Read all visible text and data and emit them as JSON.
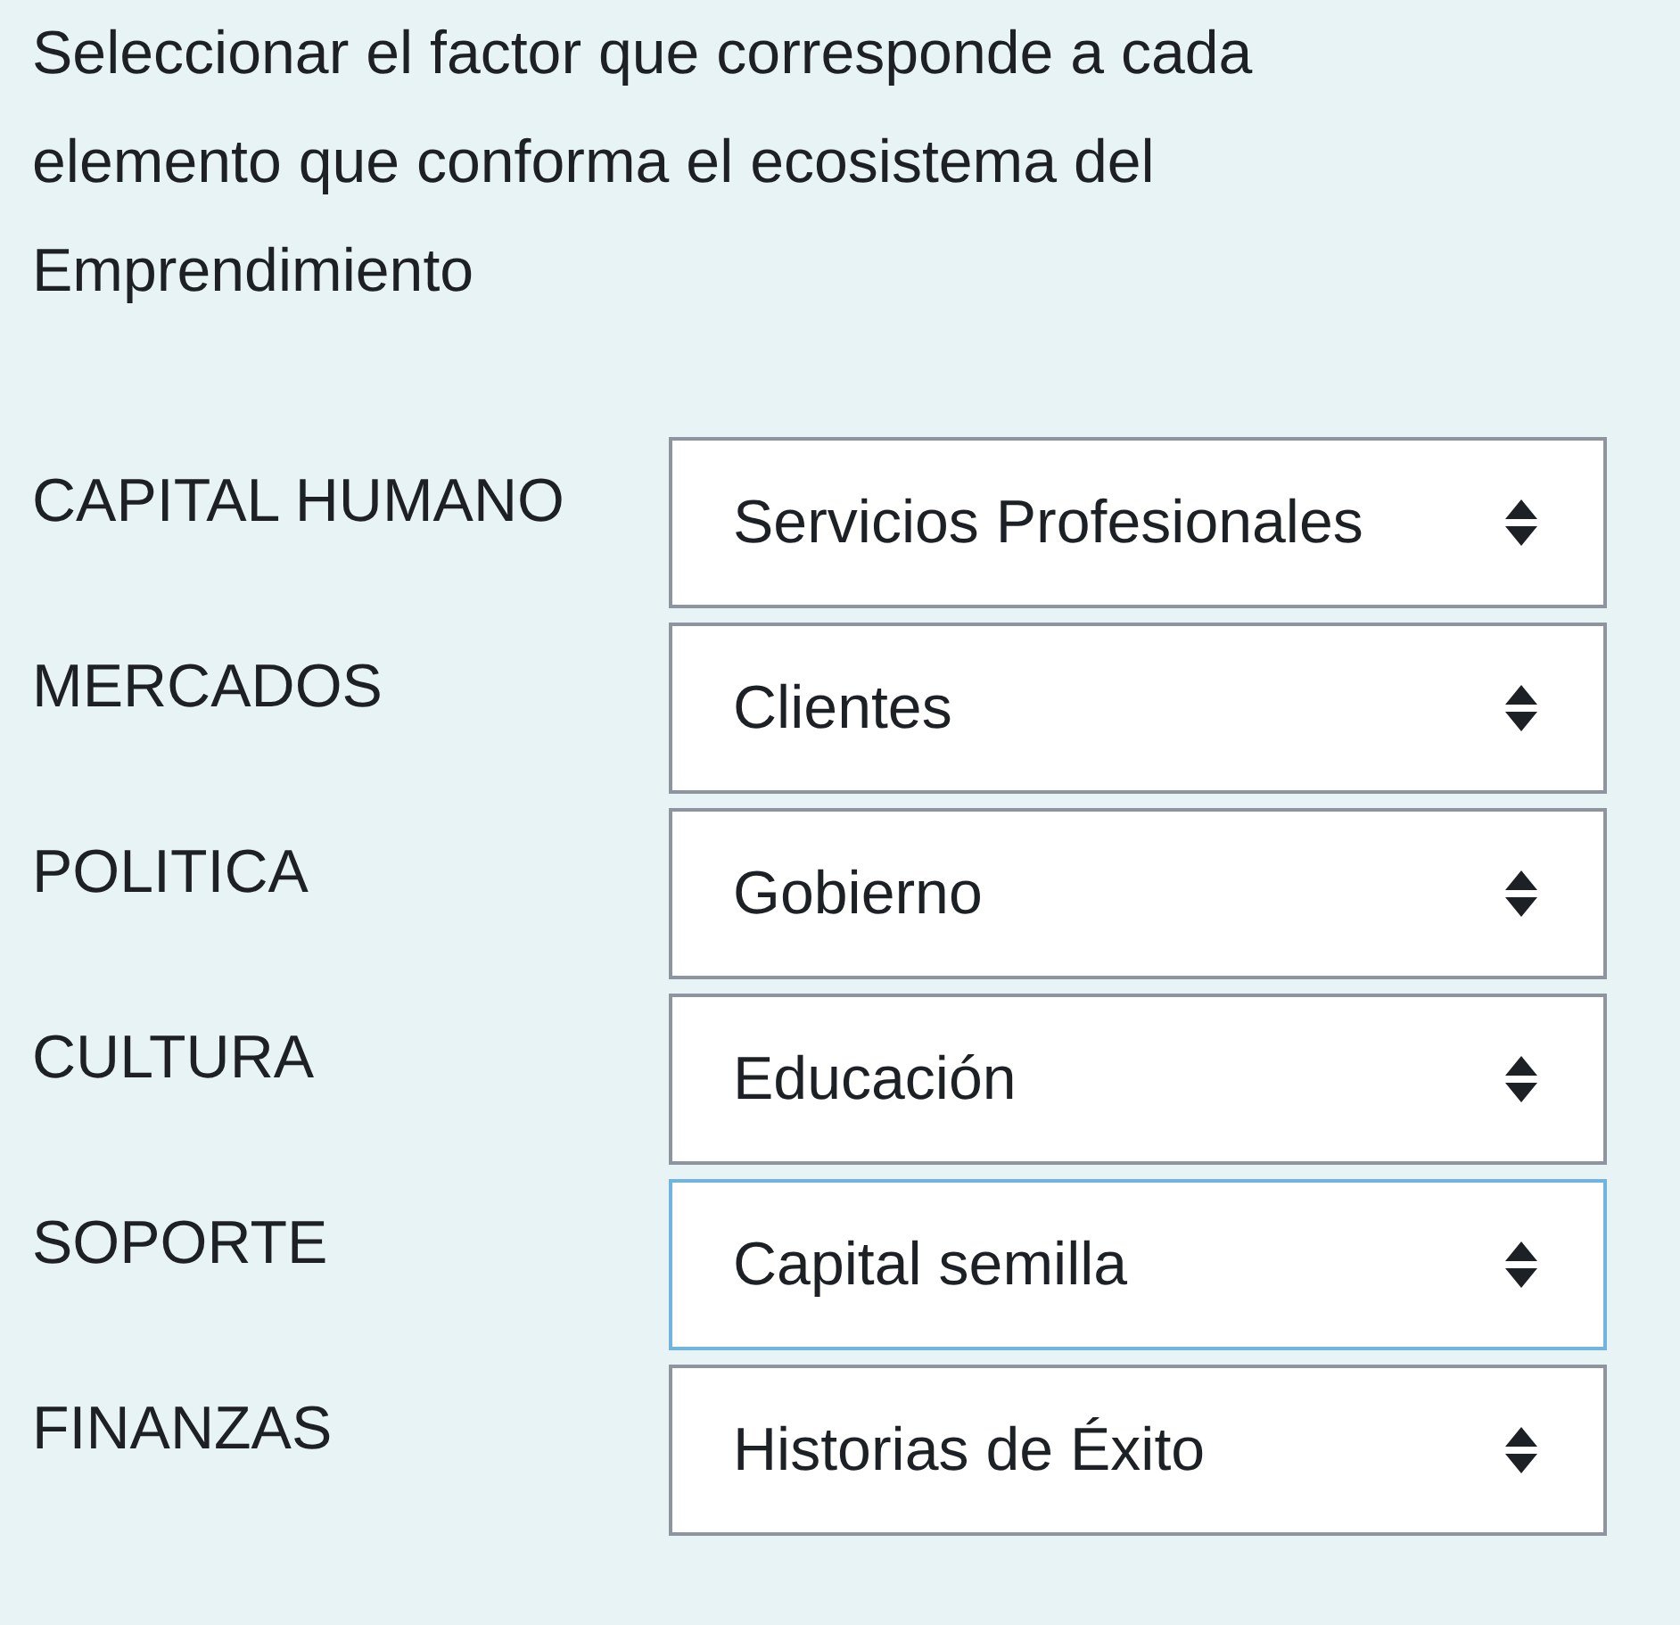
{
  "question": "Seleccionar el factor que corresponde a cada elemento que conforma el ecosistema del Emprendimiento",
  "rows": [
    {
      "label": "CAPITAL HUMANO",
      "value": "Servicios Profesionales",
      "focused": false
    },
    {
      "label": "MERCADOS",
      "value": "Clientes",
      "focused": false
    },
    {
      "label": "POLITICA",
      "value": "Gobierno",
      "focused": false
    },
    {
      "label": "CULTURA",
      "value": "Educación",
      "focused": false
    },
    {
      "label": "SOPORTE",
      "value": "Capital semilla",
      "focused": true
    },
    {
      "label": "FINANZAS",
      "value": "Historias de Éxito",
      "focused": false
    }
  ]
}
